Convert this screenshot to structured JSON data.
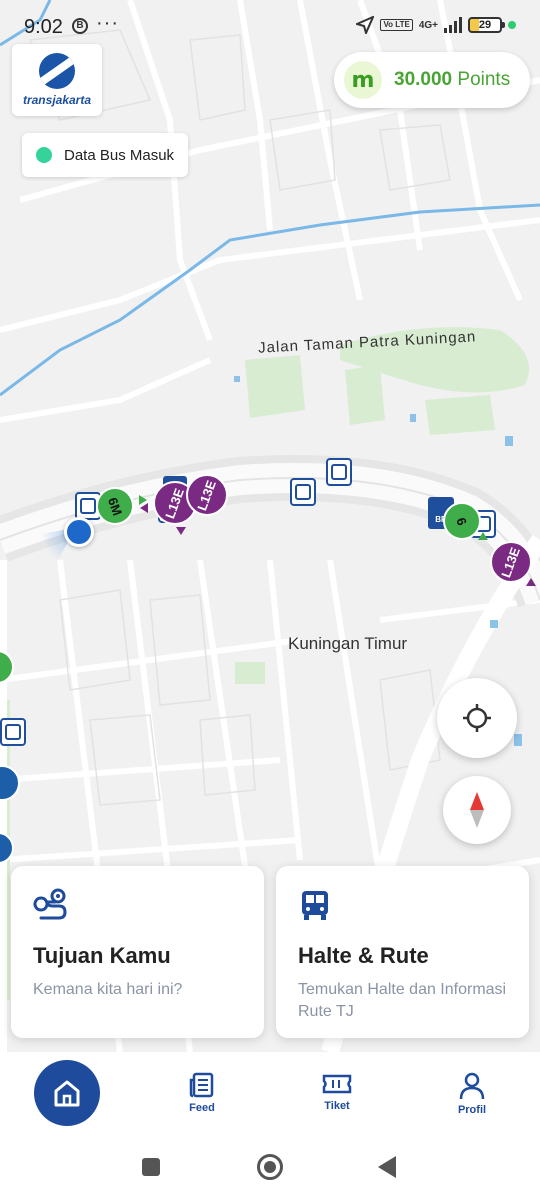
{
  "status_bar": {
    "time": "9:02",
    "notification_badge": "B",
    "more": "···",
    "volte": "Vo LTE",
    "network": "4G+",
    "battery": "29"
  },
  "brand": {
    "logo_text": "transjakarta"
  },
  "points": {
    "icon_letter": "m",
    "amount": "30.000",
    "unit": "Points"
  },
  "bus_data_chip": {
    "label": "Data Bus Masuk",
    "dot_color": "#35d39a"
  },
  "map": {
    "street_label": "Jalan Taman Patra Kuningan",
    "area_label": "Kuningan Timur",
    "buses": [
      {
        "label": "6M",
        "color": "green"
      },
      {
        "label": "L13E",
        "color": "purple"
      },
      {
        "label": "L13E",
        "color": "purple"
      },
      {
        "label": "6",
        "color": "green"
      },
      {
        "label": "L13E",
        "color": "purple"
      }
    ],
    "brt_label": "BR"
  },
  "cards": {
    "tujuan": {
      "title": "Tujuan Kamu",
      "subtitle": "Kemana kita hari ini?",
      "icon": "route-icon"
    },
    "halte": {
      "title": "Halte & Rute",
      "subtitle": "Temukan Halte dan Informasi Rute TJ",
      "icon": "bus-icon"
    }
  },
  "bottom_nav": {
    "home": "home-icon",
    "feed": "Feed",
    "tiket": "Tiket",
    "profil": "Profil"
  },
  "colors": {
    "primary": "#1e4b9b",
    "points_green": "#48a534",
    "bus_green": "#3fae4a",
    "bus_purple": "#7b2a83"
  }
}
